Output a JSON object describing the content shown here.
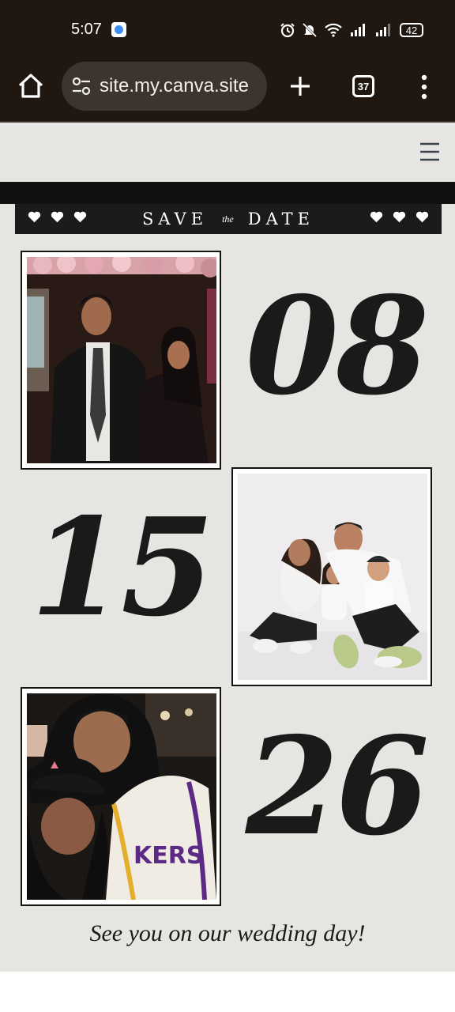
{
  "status_bar": {
    "time": "5:07",
    "battery": "42",
    "icons": [
      "app-notification-icon",
      "alarm-icon",
      "silent-icon",
      "wifi-icon",
      "signal-icon",
      "signal-icon-2",
      "battery-icon"
    ]
  },
  "browser": {
    "url": "site.my.canva.site",
    "tab_count": "37"
  },
  "banner": {
    "title_left": "SAVE",
    "title_middle": "the",
    "title_right": "DATE"
  },
  "date": {
    "month": "08",
    "day": "15",
    "year": "26"
  },
  "footer": {
    "message": "See you on our wedding day!"
  },
  "colors": {
    "background": "#e7e5e1",
    "dark": "#1b1b1b",
    "browser_bar": "#1f1710"
  }
}
